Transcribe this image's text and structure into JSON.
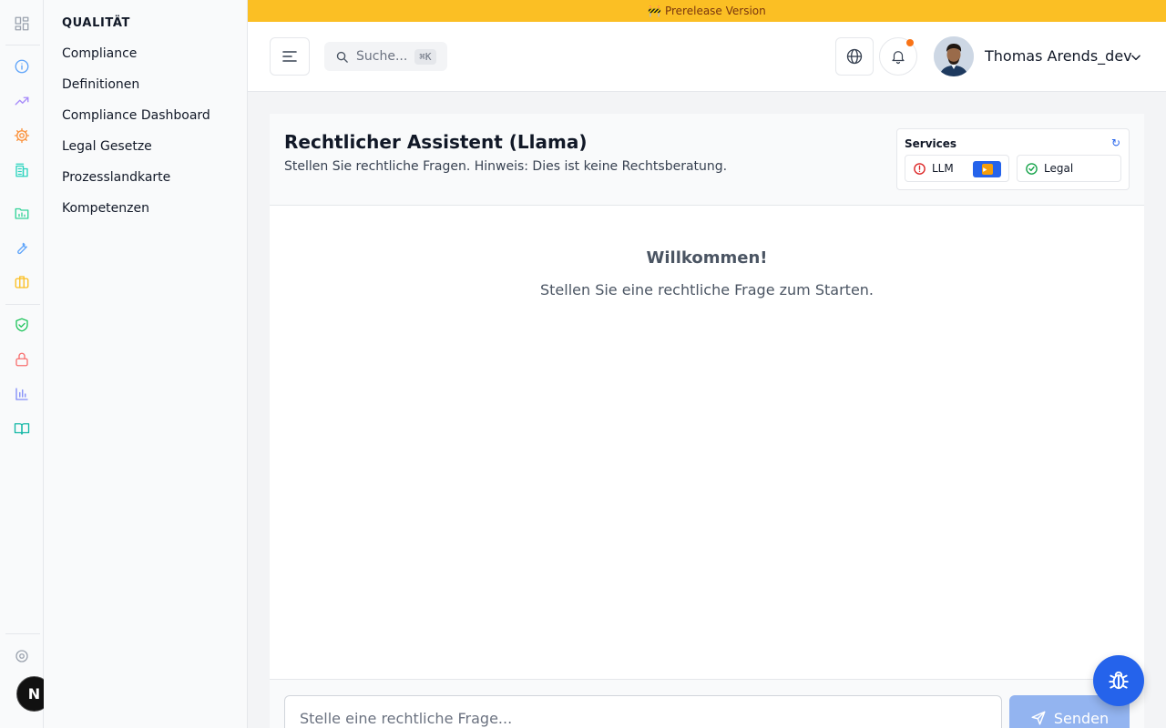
{
  "banner": {
    "icon": "construction-icon",
    "text": "🚧 Prerelease Version"
  },
  "rail": {
    "icons": [
      {
        "name": "grid-icon",
        "color": "#9ca3af"
      },
      {
        "name": "info-icon",
        "color": "#60a5fa"
      },
      {
        "name": "trending-up-icon",
        "color": "#a78bfa"
      },
      {
        "name": "cog-icon",
        "color": "#fb923c"
      },
      {
        "name": "building-icon",
        "color": "#2dd4bf"
      },
      {
        "name": "folder-chart-icon",
        "color": "#34d399"
      },
      {
        "name": "wrench-icon",
        "color": "#60a5fa"
      },
      {
        "name": "briefcase-icon",
        "color": "#fbbf24"
      },
      {
        "name": "shield-check-icon",
        "color": "#22c55e"
      },
      {
        "name": "lock-icon",
        "color": "#f87171"
      },
      {
        "name": "bar-chart-icon",
        "color": "#818cf8"
      },
      {
        "name": "book-open-icon",
        "color": "#14b8a6"
      },
      {
        "name": "settings-icon",
        "color": "#9ca3af"
      }
    ]
  },
  "subnav": {
    "title": "QUALITÄT",
    "items": [
      {
        "label": "Compliance"
      },
      {
        "label": "Definitionen"
      },
      {
        "label": "Compliance Dashboard"
      },
      {
        "label": "Legal Gesetze"
      },
      {
        "label": "Prozesslandkarte"
      },
      {
        "label": "Kompetenzen"
      }
    ]
  },
  "topbar": {
    "search_placeholder": "Suche...",
    "search_shortcut": "⌘K",
    "user_name": "Thomas Arends_dev"
  },
  "panel": {
    "title": "Rechtlicher Assistent (Llama)",
    "subtitle": "Stellen Sie rechtliche Fragen. Hinweis: Dies ist keine Rechtsberatung.",
    "services": {
      "title": "Services",
      "refresh": "↻",
      "items": [
        {
          "label": "LLM",
          "status": "error",
          "status_color": "#dc2626"
        },
        {
          "label": "Legal",
          "status": "ok",
          "status_color": "#16a34a"
        }
      ]
    },
    "welcome_title": "Willkommen!",
    "welcome_text": "Stellen Sie eine rechtliche Frage zum Starten."
  },
  "composer": {
    "placeholder": "Stelle eine rechtliche Frage...",
    "send_label": "Senden"
  },
  "colors": {
    "accent": "#2563eb",
    "banner": "#fbbf24",
    "notification_dot": "#f97316"
  },
  "next_badge": "N"
}
